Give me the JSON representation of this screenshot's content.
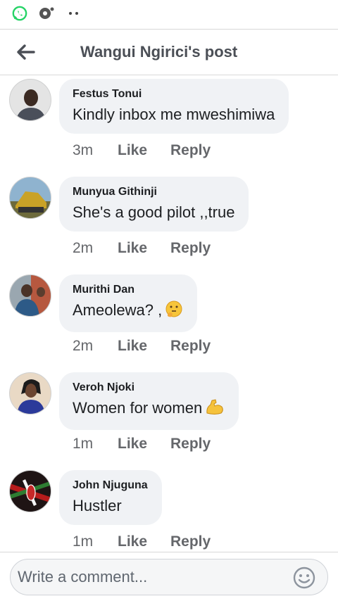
{
  "header": {
    "title": "Wangui Ngirici's post"
  },
  "comments": [
    {
      "name": "Festus Tonui",
      "text": "Kindly inbox me mweshimiwa",
      "emoji": "",
      "time": "3m",
      "like": "Like",
      "reply": "Reply",
      "avatar_color": "#9e9e9e"
    },
    {
      "name": "Munyua Githinji",
      "text": "She's a good pilot ,,true",
      "emoji": "",
      "time": "2m",
      "like": "Like",
      "reply": "Reply",
      "avatar_color": "#8d7b3e"
    },
    {
      "name": "Murithi Dan",
      "text": "Ameolewa? ,",
      "emoji": "thinking-face-emoji",
      "time": "2m",
      "like": "Like",
      "reply": "Reply",
      "avatar_color": "#6d8fa8"
    },
    {
      "name": "Veroh Njoki",
      "text": "Women for women",
      "emoji": "flexed-biceps-emoji",
      "time": "1m",
      "like": "Like",
      "reply": "Reply",
      "avatar_color": "#c8a37a"
    },
    {
      "name": "John Njuguna",
      "text": "Hustler",
      "emoji": "",
      "time": "1m",
      "like": "Like",
      "reply": "Reply",
      "avatar_color": "#3a1010"
    }
  ],
  "composer": {
    "placeholder": "Write a comment..."
  },
  "colors": {
    "bubble": "#f0f2f5",
    "meta_text": "#65676b",
    "whatsapp": "#25d366"
  }
}
